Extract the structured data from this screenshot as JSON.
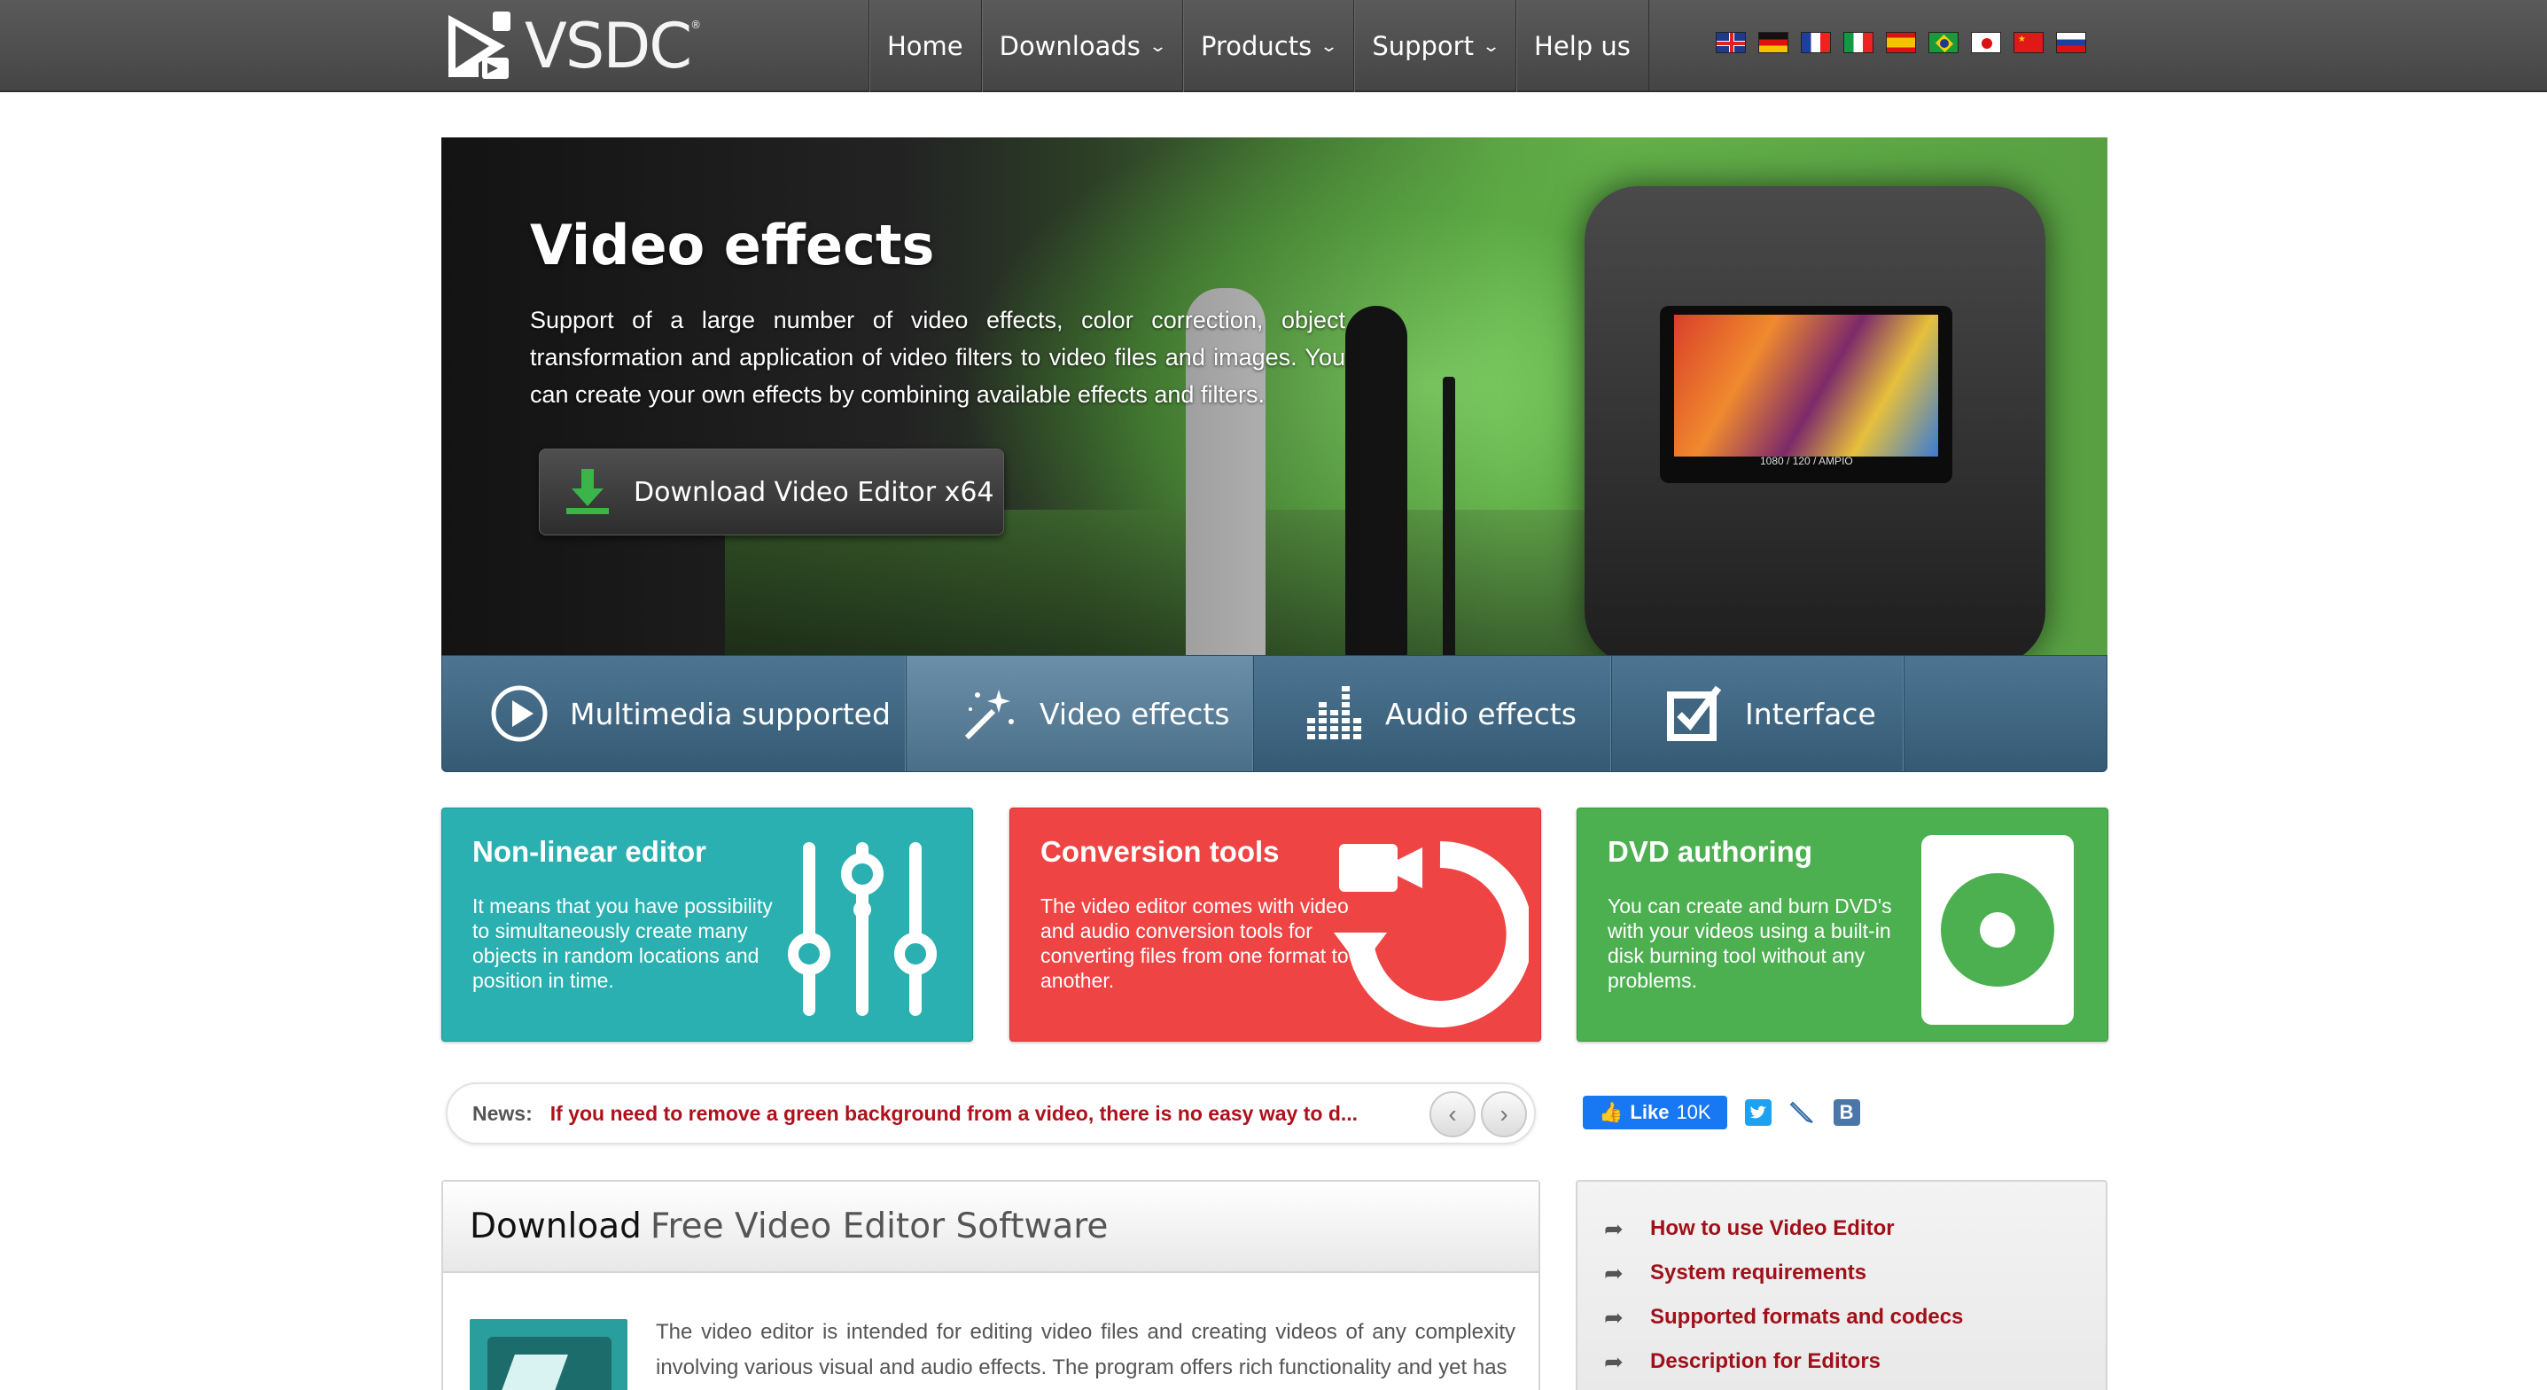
{
  "brand": {
    "logo_text": "VSDC",
    "reg": "®"
  },
  "nav": {
    "items": [
      {
        "label": "Home",
        "dropdown": false
      },
      {
        "label": "Downloads",
        "dropdown": true
      },
      {
        "label": "Products",
        "dropdown": true
      },
      {
        "label": "Support",
        "dropdown": true
      },
      {
        "label": "Help us",
        "dropdown": false
      }
    ],
    "languages": [
      "english-flag",
      "german-flag",
      "french-flag",
      "italian-flag",
      "spanish-flag",
      "brazilian-flag",
      "japanese-flag",
      "chinese-flag",
      "russian-flag"
    ]
  },
  "hero": {
    "title": "Video effects",
    "description": "Support of a large number of video effects, color correction, object transformation and application of video filters to video files and images. You can create your own effects by combining available effects and filters.",
    "download_button": "Download Video Editor x64",
    "screen_caption": "1080 / 120 / AMPIO"
  },
  "feature_tabs": [
    {
      "label": "Multimedia supported",
      "icon": "play-circle-icon",
      "active": false
    },
    {
      "label": "Video effects",
      "icon": "magic-wand-icon",
      "active": true
    },
    {
      "label": "Audio effects",
      "icon": "equalizer-icon",
      "active": false
    },
    {
      "label": "Interface",
      "icon": "edit-checkbox-icon",
      "active": false
    }
  ],
  "cards": [
    {
      "title": "Non-linear editor",
      "text": "It means that you have possibility to simultaneously create many objects in random locations and position in time.",
      "color": "#2ab0b0",
      "icon": "sliders-icon"
    },
    {
      "title": "Conversion tools",
      "text": "The video editor comes with video and audio conversion tools for converting files from one format to another.",
      "color": "#ef4444",
      "icon": "video-convert-icon"
    },
    {
      "title": "DVD authoring",
      "text": "You can create and burn DVD's with your videos using a built-in disk burning tool without any problems.",
      "color": "#4caf50",
      "icon": "disc-icon"
    }
  ],
  "news": {
    "label": "News:",
    "headline": "If you need to remove a green background from a video, there is no easy way to d..."
  },
  "social": {
    "like_label": "Like",
    "like_count": "10K",
    "icons": [
      "twitter-icon",
      "livejournal-icon",
      "vk-icon"
    ]
  },
  "download_panel": {
    "title_strong": "Download",
    "title_light": "Free Video Editor Software",
    "text": "The video editor is intended for editing video files and creating videos of any complexity involving various visual and audio effects. The program offers rich functionality and yet has"
  },
  "side_links": [
    "How to use Video Editor",
    "System requirements",
    "Supported formats and codecs",
    "Description for Editors"
  ],
  "colors": {
    "topbar": "#4f4f4f",
    "tabs": "#3f6580",
    "link_red": "#a0101a",
    "download_green": "#3bb54a"
  }
}
